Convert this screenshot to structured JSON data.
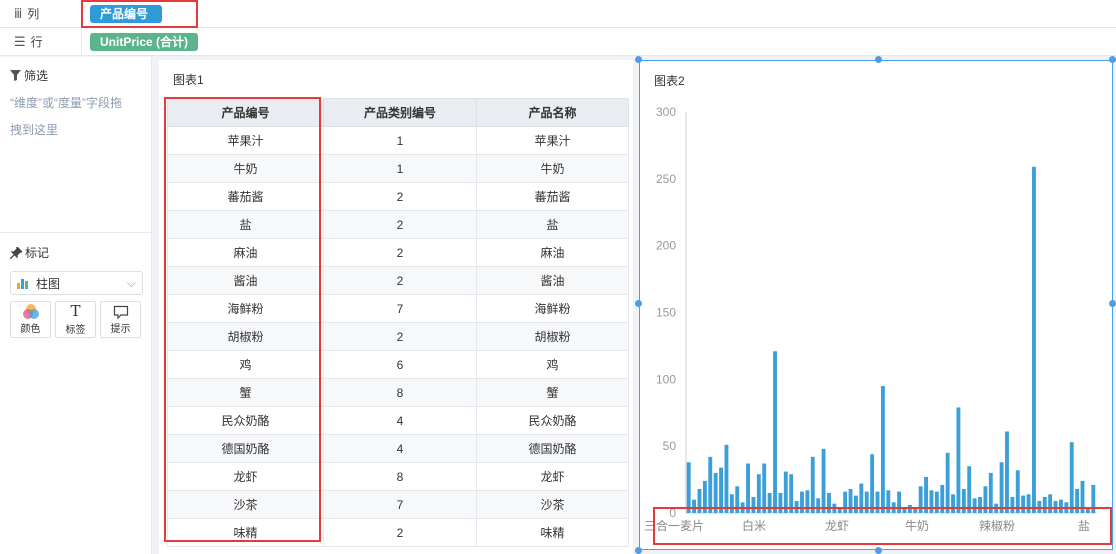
{
  "shelves": {
    "columns": {
      "icon": "bars-icon",
      "label": "列",
      "pill": "产品编号"
    },
    "rows": {
      "icon": "list-icon",
      "label": "行",
      "pill": "UnitPrice (合计)"
    }
  },
  "filter": {
    "title": "筛选",
    "hint": "“维度”或“度量”字段拖拽到这里"
  },
  "marks": {
    "title": "标记",
    "chart_type": "柱图",
    "buttons": [
      {
        "label": "颜色",
        "icon": "color-circles-icon"
      },
      {
        "label": "标签",
        "icon": "text-T-icon"
      },
      {
        "label": "提示",
        "icon": "tooltip-icon"
      }
    ]
  },
  "chart1": {
    "title": "图表1",
    "headers": [
      "产品编号",
      "产品类别编号",
      "产品名称"
    ],
    "rows": [
      [
        "苹果汁",
        "1",
        "苹果汁"
      ],
      [
        "牛奶",
        "1",
        "牛奶"
      ],
      [
        "蕃茄酱",
        "2",
        "蕃茄酱"
      ],
      [
        "盐",
        "2",
        "盐"
      ],
      [
        "麻油",
        "2",
        "麻油"
      ],
      [
        "酱油",
        "2",
        "酱油"
      ],
      [
        "海鲜粉",
        "7",
        "海鲜粉"
      ],
      [
        "胡椒粉",
        "2",
        "胡椒粉"
      ],
      [
        "鸡",
        "6",
        "鸡"
      ],
      [
        "蟹",
        "8",
        "蟹"
      ],
      [
        "民众奶酪",
        "4",
        "民众奶酪"
      ],
      [
        "德国奶酪",
        "4",
        "德国奶酪"
      ],
      [
        "龙虾",
        "8",
        "龙虾"
      ],
      [
        "沙茶",
        "7",
        "沙茶"
      ],
      [
        "味精",
        "2",
        "味精"
      ]
    ]
  },
  "chart2": {
    "title": "图表2"
  },
  "colors": {
    "accent": "#2e9bd6",
    "bar": "#3b9fd8",
    "highlight": "#e33b3b",
    "pill_green": "#5bb58c"
  },
  "chart_data": {
    "type": "bar",
    "ylim": [
      0,
      300
    ],
    "yticks": [
      0,
      50,
      100,
      150,
      200,
      250,
      300
    ],
    "xtick_labels": [
      "三合一麦片",
      "白米",
      "龙虾",
      "牛奶",
      "辣椒粉",
      "盐"
    ],
    "values": [
      38,
      10,
      18,
      24,
      42,
      30,
      34,
      51,
      14,
      20,
      8,
      37,
      12,
      29,
      37,
      15,
      121,
      15,
      31,
      29,
      9,
      16,
      17,
      42,
      11,
      48,
      15,
      7,
      4,
      16,
      18,
      13,
      22,
      16,
      44,
      16,
      95,
      17,
      8,
      16,
      3,
      6,
      3,
      20,
      27,
      17,
      16,
      21,
      45,
      14,
      79,
      18,
      35,
      11,
      12,
      20,
      30,
      7,
      38,
      61,
      12,
      32,
      13,
      14,
      259,
      9,
      12,
      14,
      9,
      10,
      8,
      53,
      18,
      24,
      3,
      21
    ]
  }
}
